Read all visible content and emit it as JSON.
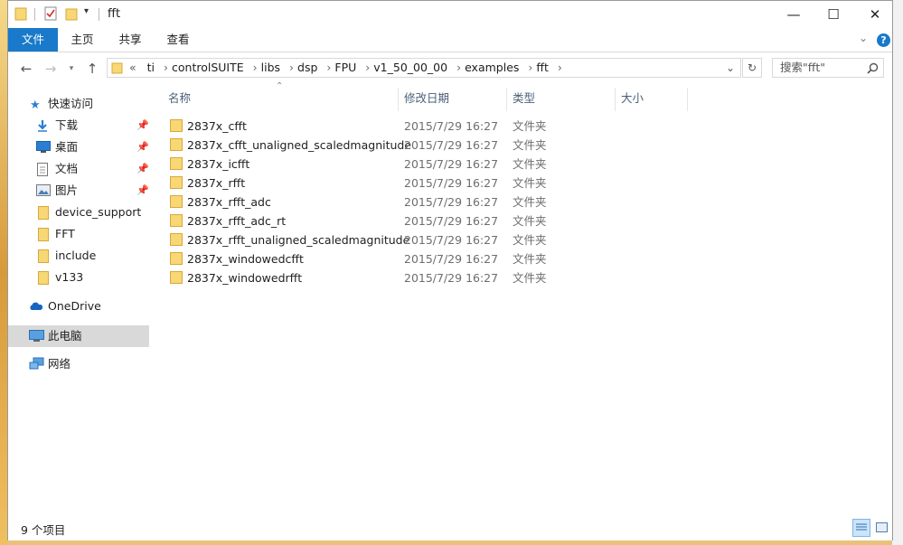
{
  "window": {
    "title": "fft"
  },
  "ribbon": {
    "tabs": [
      "文件",
      "主页",
      "共享",
      "查看"
    ]
  },
  "address": {
    "overflow": "«",
    "crumbs": [
      "ti",
      "controlSUITE",
      "libs",
      "dsp",
      "FPU",
      "v1_50_00_00",
      "examples",
      "fft"
    ]
  },
  "search": {
    "placeholder": "搜索\"fft\""
  },
  "nav": {
    "quick_access": "快速访问",
    "pinned": [
      "下载",
      "桌面",
      "文档",
      "图片"
    ],
    "folders": [
      "device_support",
      "FFT",
      "include",
      "v133"
    ],
    "onedrive": "OneDrive",
    "this_pc": "此电脑",
    "network": "网络"
  },
  "columns": {
    "name": "名称",
    "date": "修改日期",
    "type": "类型",
    "size": "大小"
  },
  "files": [
    {
      "name": "2837x_cfft",
      "date": "2015/7/29 16:27",
      "type": "文件夹"
    },
    {
      "name": "2837x_cfft_unaligned_scaledmagnitude",
      "date": "2015/7/29 16:27",
      "type": "文件夹"
    },
    {
      "name": "2837x_icfft",
      "date": "2015/7/29 16:27",
      "type": "文件夹"
    },
    {
      "name": "2837x_rfft",
      "date": "2015/7/29 16:27",
      "type": "文件夹"
    },
    {
      "name": "2837x_rfft_adc",
      "date": "2015/7/29 16:27",
      "type": "文件夹"
    },
    {
      "name": "2837x_rfft_adc_rt",
      "date": "2015/7/29 16:27",
      "type": "文件夹"
    },
    {
      "name": "2837x_rfft_unaligned_scaledmagnitude",
      "date": "2015/7/29 16:27",
      "type": "文件夹"
    },
    {
      "name": "2837x_windowedcfft",
      "date": "2015/7/29 16:27",
      "type": "文件夹"
    },
    {
      "name": "2837x_windowedrfft",
      "date": "2015/7/29 16:27",
      "type": "文件夹"
    }
  ],
  "status": {
    "count": "9 个项目"
  },
  "colors": {
    "accent": "#1979ca",
    "folder": "#f8d775",
    "selected_nav": "#d9d9d9"
  }
}
